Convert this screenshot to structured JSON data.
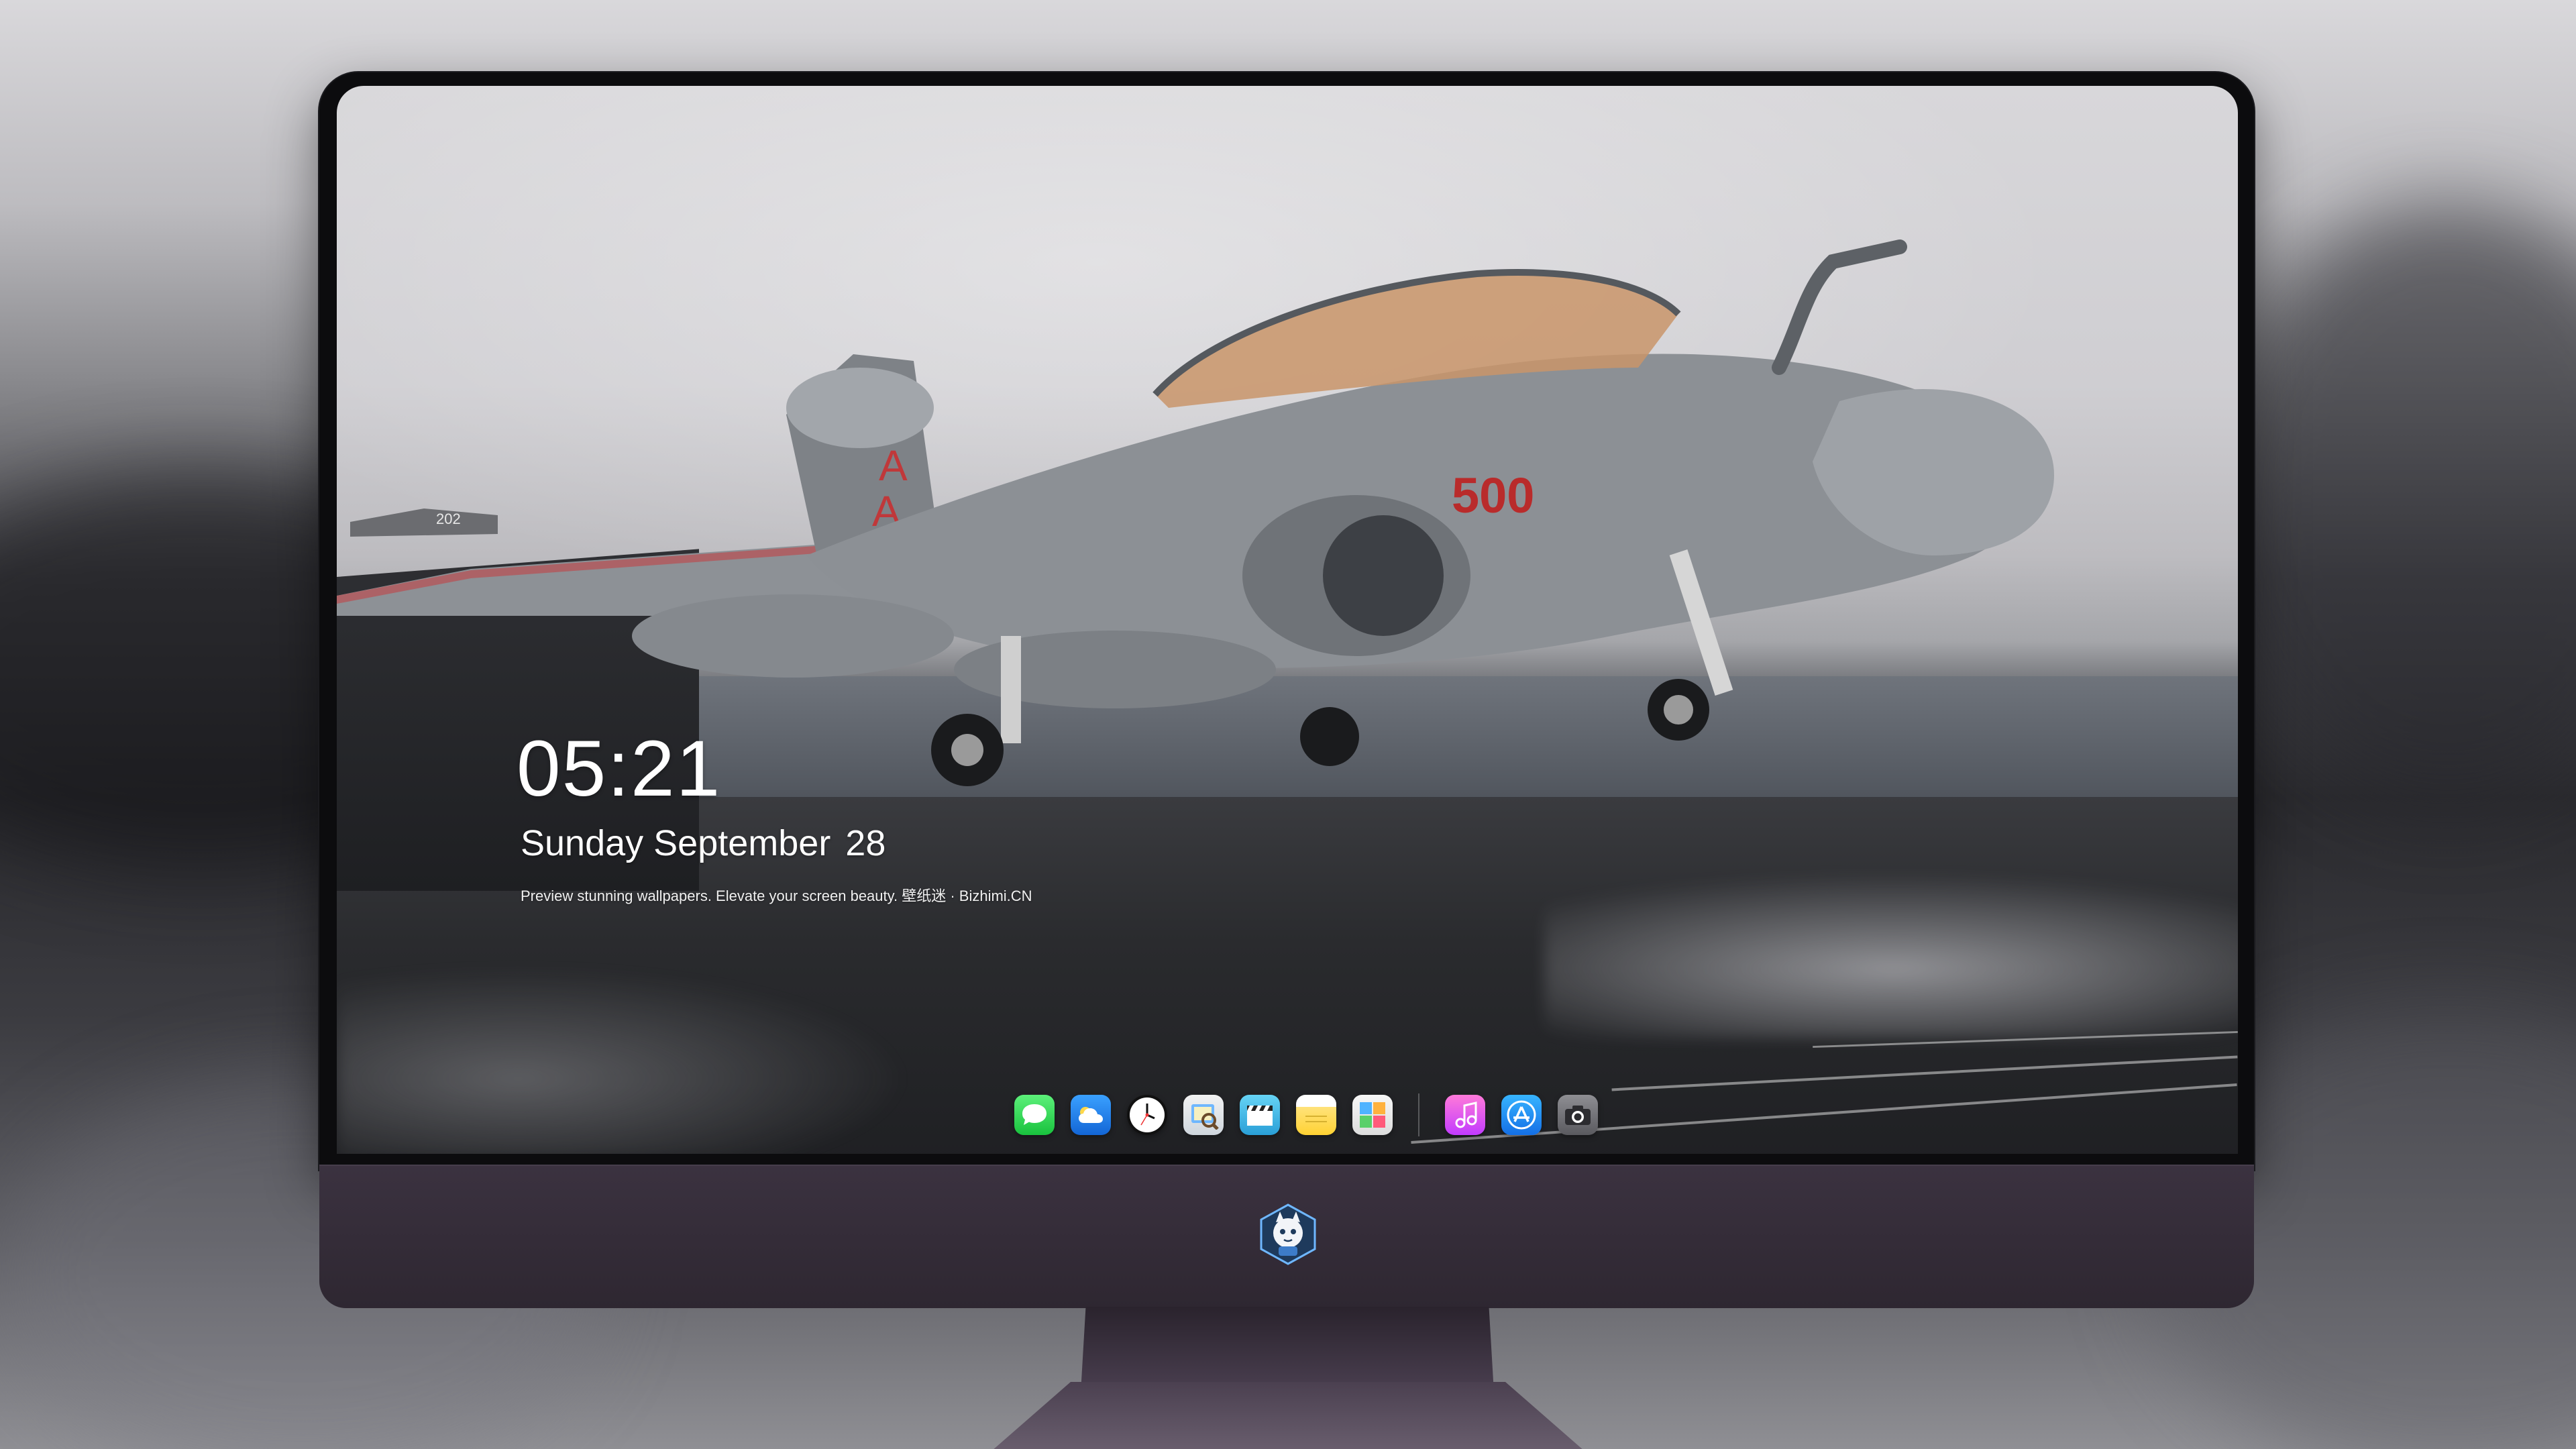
{
  "lock_screen": {
    "time": "05:21",
    "weekday_month": "Sunday September",
    "day": "28",
    "tagline": "Preview stunning wallpapers. Elevate your screen beauty. 壁纸迷 · Bizhimi.CN"
  },
  "wallpaper": {
    "aircraft_side_number": "500",
    "tail_letters": "A",
    "background_aircraft_number": "202"
  },
  "dock": {
    "apps": [
      {
        "name": "Messages",
        "icon": "speech-bubble-icon"
      },
      {
        "name": "Weather",
        "icon": "cloud-icon"
      },
      {
        "name": "Clock",
        "icon": "clock-icon"
      },
      {
        "name": "Preview",
        "icon": "preview-icon"
      },
      {
        "name": "Clips",
        "icon": "clapperboard-icon"
      },
      {
        "name": "Notes",
        "icon": "notes-icon"
      },
      {
        "name": "Photo Booth",
        "icon": "photo-grid-icon"
      },
      {
        "name": "Music",
        "icon": "music-note-icon"
      },
      {
        "name": "App Store",
        "icon": "app-store-icon"
      },
      {
        "name": "Camera",
        "icon": "camera-icon"
      }
    ]
  },
  "colors": {
    "chin": "#3b3240",
    "bezel": "#0c0c0e",
    "clock_text": "#ffffff",
    "side_number": "#c22d2d"
  }
}
